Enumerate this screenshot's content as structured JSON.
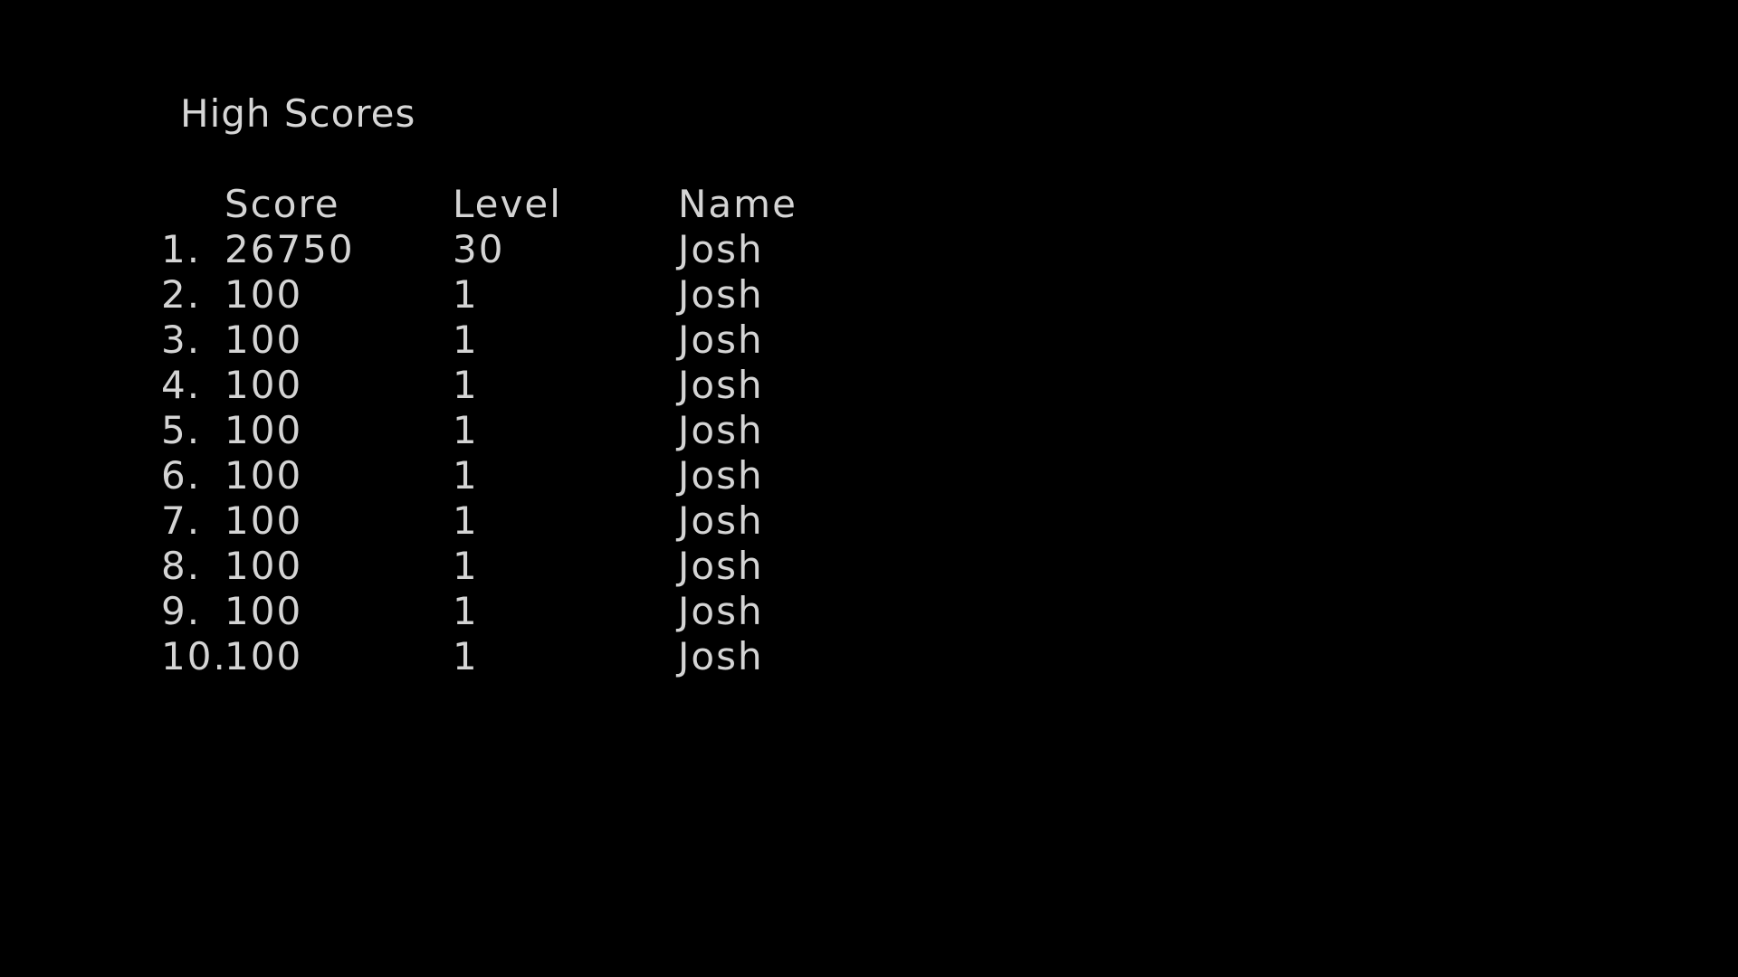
{
  "title": "High Scores",
  "columns": {
    "score": "Score",
    "level": "Level",
    "name": "Name"
  },
  "rows": [
    {
      "rank": "1.",
      "score": "26750",
      "level": "30",
      "name": "Josh"
    },
    {
      "rank": "2.",
      "score": "100",
      "level": "1",
      "name": "Josh"
    },
    {
      "rank": "3.",
      "score": "100",
      "level": "1",
      "name": "Josh"
    },
    {
      "rank": "4.",
      "score": "100",
      "level": "1",
      "name": "Josh"
    },
    {
      "rank": "5.",
      "score": "100",
      "level": "1",
      "name": "Josh"
    },
    {
      "rank": "6.",
      "score": "100",
      "level": "1",
      "name": "Josh"
    },
    {
      "rank": "7.",
      "score": "100",
      "level": "1",
      "name": "Josh"
    },
    {
      "rank": "8.",
      "score": "100",
      "level": "1",
      "name": "Josh"
    },
    {
      "rank": "9.",
      "score": "100",
      "level": "1",
      "name": "Josh"
    },
    {
      "rank": "10.",
      "score": "100",
      "level": "1",
      "name": "Josh"
    }
  ],
  "colors": {
    "background": "#000000",
    "text": "#d4d4d4"
  }
}
